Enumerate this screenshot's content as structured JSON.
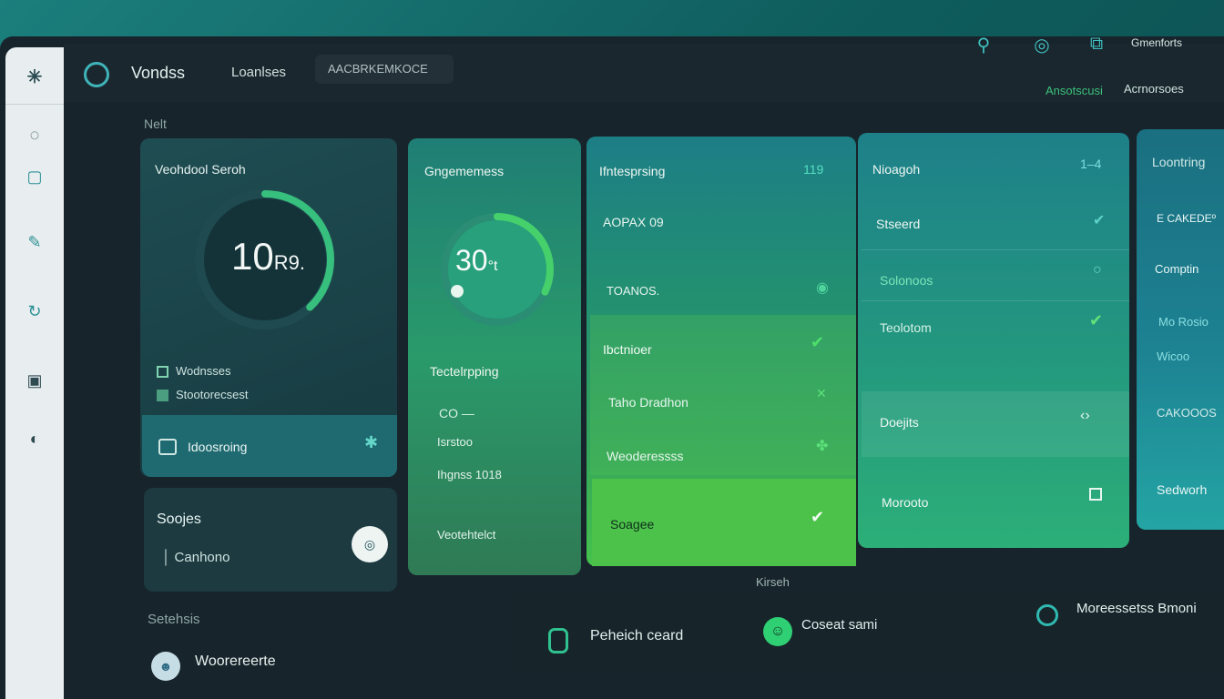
{
  "sidebar": {
    "logo": "✳",
    "items": [
      "◌",
      "▢",
      "✎",
      "↻",
      "▣",
      "◐"
    ]
  },
  "header": {
    "app_name": "Vondss",
    "tab": "Loanlses",
    "search_placeholder": "AACBRKEMKOCE",
    "profile": "Gmenforts",
    "status_green": "Ansotscusi",
    "status_white": "Acrnorsoes"
  },
  "section_header": "Nelt",
  "card1": {
    "title": "Veohdool Seroh",
    "gauge_value": "10",
    "gauge_unit": "R9.",
    "gauge_progress": 0.38,
    "legend": [
      "Wodnsses",
      "Stootorecsest"
    ],
    "footer": "Idoosroing",
    "footer_icon": "✱"
  },
  "card_small": {
    "title": "Soojes",
    "subtitle": "Canhono",
    "fab": "◎"
  },
  "card2": {
    "title": "Gngememess",
    "gauge_value": "30",
    "gauge_unit": "°t",
    "gauge_progress": 0.32,
    "subtitle": "Tectelrpping",
    "chip": "CO —",
    "v1": "Isrstoo",
    "v2": "Ihgnss  1018",
    "footer": "Veotehtelct"
  },
  "card3": {
    "title": "Ifntesprsing",
    "num": "119",
    "rows": [
      "AOPAX 09",
      "TOANOS.",
      "Ibctnioer",
      "Taho Dradhon",
      "Weoderessss",
      "Soagee"
    ],
    "icons": [
      "◉",
      "✔",
      "✕",
      "✤",
      "✔"
    ]
  },
  "card4": {
    "title": "Nioagoh",
    "num": "1‒4",
    "rows": [
      "Stseerd",
      "Solonoos",
      "Teolotom",
      "Doejits",
      "Morooto"
    ],
    "icons": [
      "✔",
      "○",
      "✔",
      "‹›"
    ]
  },
  "card5": {
    "title": "Loontring",
    "rows": [
      "E CAKEDEº",
      "Comptin",
      "Mo Rosio",
      "Wicoo",
      "CAKOOOS",
      "Sedworh"
    ]
  },
  "kitch": "Kirseh",
  "footer": {
    "section": "Setehsis",
    "user": "Woorereerte",
    "buttons": [
      "Peheich ceard",
      "Coseat sami",
      "Moreessetss Bmoni"
    ]
  },
  "colors": {
    "accent_green": "#46c24d",
    "accent_teal": "#3fb4b8",
    "background": "#18242b"
  }
}
